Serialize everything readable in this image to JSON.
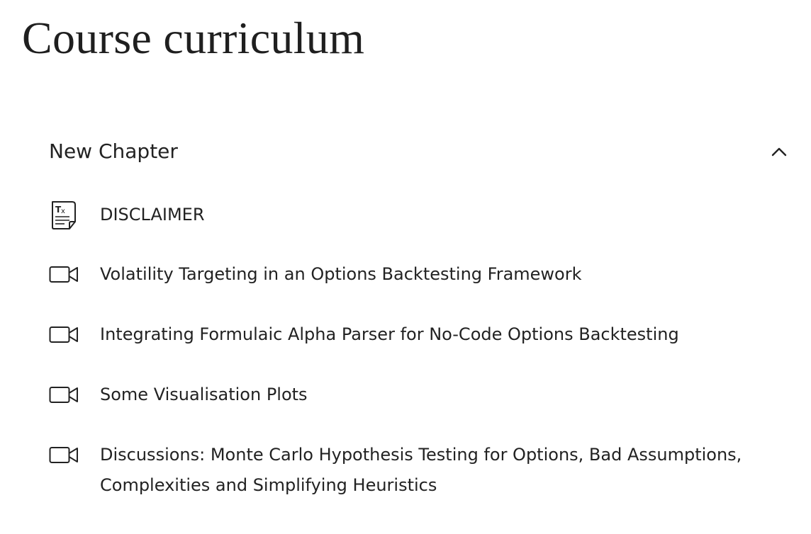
{
  "page": {
    "title": "Course curriculum"
  },
  "chapter": {
    "title": "New Chapter",
    "expanded": true,
    "toggle_icon": "chevron-up-icon"
  },
  "lessons": [
    {
      "title": "DISCLAIMER",
      "icon": "text-document-icon"
    },
    {
      "title": "Volatility Targeting in an Options Backtesting Framework",
      "icon": "video-camera-icon"
    },
    {
      "title": "Integrating Formulaic Alpha Parser for No-Code Options Backtesting",
      "icon": "video-camera-icon"
    },
    {
      "title": "Some Visualisation Plots",
      "icon": "video-camera-icon"
    },
    {
      "title": "Discussions: Monte Carlo Hypothesis Testing for Options, Bad Assumptions, Complexities and Simplifying Heuristics",
      "icon": "video-camera-icon"
    }
  ]
}
